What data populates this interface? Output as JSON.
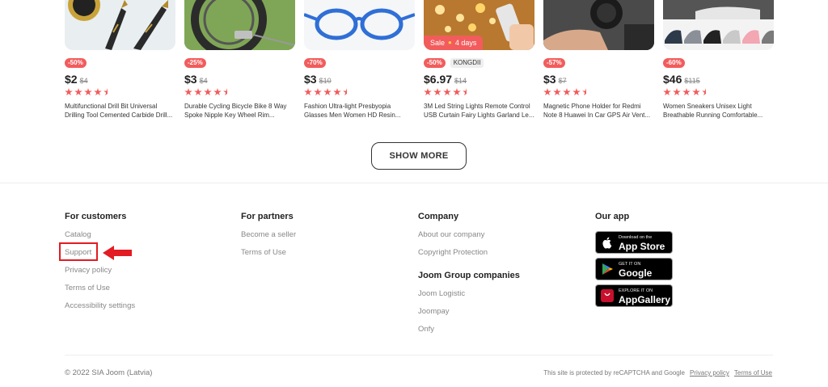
{
  "products": [
    {
      "discount": "-50%",
      "price": "$2",
      "old_price": "$4",
      "rating": 4.5,
      "title": "Multifunctional Drill Bit Universal Drilling Tool Cemented Carbide Drill..."
    },
    {
      "discount": "-25%",
      "price": "$3",
      "old_price": "$4",
      "rating": 4.5,
      "title": "Durable Cycling Bicycle Bike 8 Way Spoke Nipple Key Wheel Rim..."
    },
    {
      "discount": "-70%",
      "price": "$3",
      "old_price": "$10",
      "rating": 4.5,
      "title": "Fashion Ultra-light Presbyopia Glasses Men Women HD Resin..."
    },
    {
      "discount": "-50%",
      "brand": "KONGDII",
      "sale_label": "Sale",
      "sale_time": "4 days",
      "price": "$6.97",
      "old_price": "$14",
      "rating": 4.5,
      "title": "3M Led String Lights Remote Control USB Curtain Fairy Lights Garland Le..."
    },
    {
      "discount": "-57%",
      "price": "$3",
      "old_price": "$7",
      "rating": 4.5,
      "title": "Magnetic Phone Holder for Redmi Note 8 Huawei In Car GPS Air Vent..."
    },
    {
      "discount": "-60%",
      "price": "$46",
      "old_price": "$115",
      "rating": 4.5,
      "title": "Women Sneakers Unisex Light Breathable Running Comfortable..."
    }
  ],
  "show_more_label": "SHOW MORE",
  "footer": {
    "customers": {
      "heading": "For customers",
      "links": [
        "Catalog",
        "Support",
        "Privacy policy",
        "Terms of Use",
        "Accessibility settings"
      ]
    },
    "partners": {
      "heading": "For partners",
      "links": [
        "Become a seller",
        "Terms of Use"
      ]
    },
    "company": {
      "heading": "Company",
      "links": [
        "About our company",
        "Copyright Protection"
      ]
    },
    "group": {
      "heading": "Joom Group companies",
      "links": [
        "Joom Logistic",
        "Joompay",
        "Onfy"
      ]
    },
    "app": {
      "heading": "Our app",
      "stores": [
        {
          "small": "Download on the",
          "big": "App Store",
          "icon": "apple-icon"
        },
        {
          "small": "GET IT ON",
          "big": "Google Play",
          "icon": "google-play-icon"
        },
        {
          "small": "EXPLORE IT ON",
          "big": "AppGallery",
          "icon": "huawei-icon"
        }
      ]
    },
    "copyright": "© 2022 SIA Joom (Latvia)",
    "recaptcha_text": "This site is protected by reCAPTCHA and Google",
    "privacy_link": "Privacy policy",
    "terms_link": "Terms of Use"
  },
  "colors": {
    "accent": "#f25c5c",
    "highlight": "#e31b23"
  }
}
